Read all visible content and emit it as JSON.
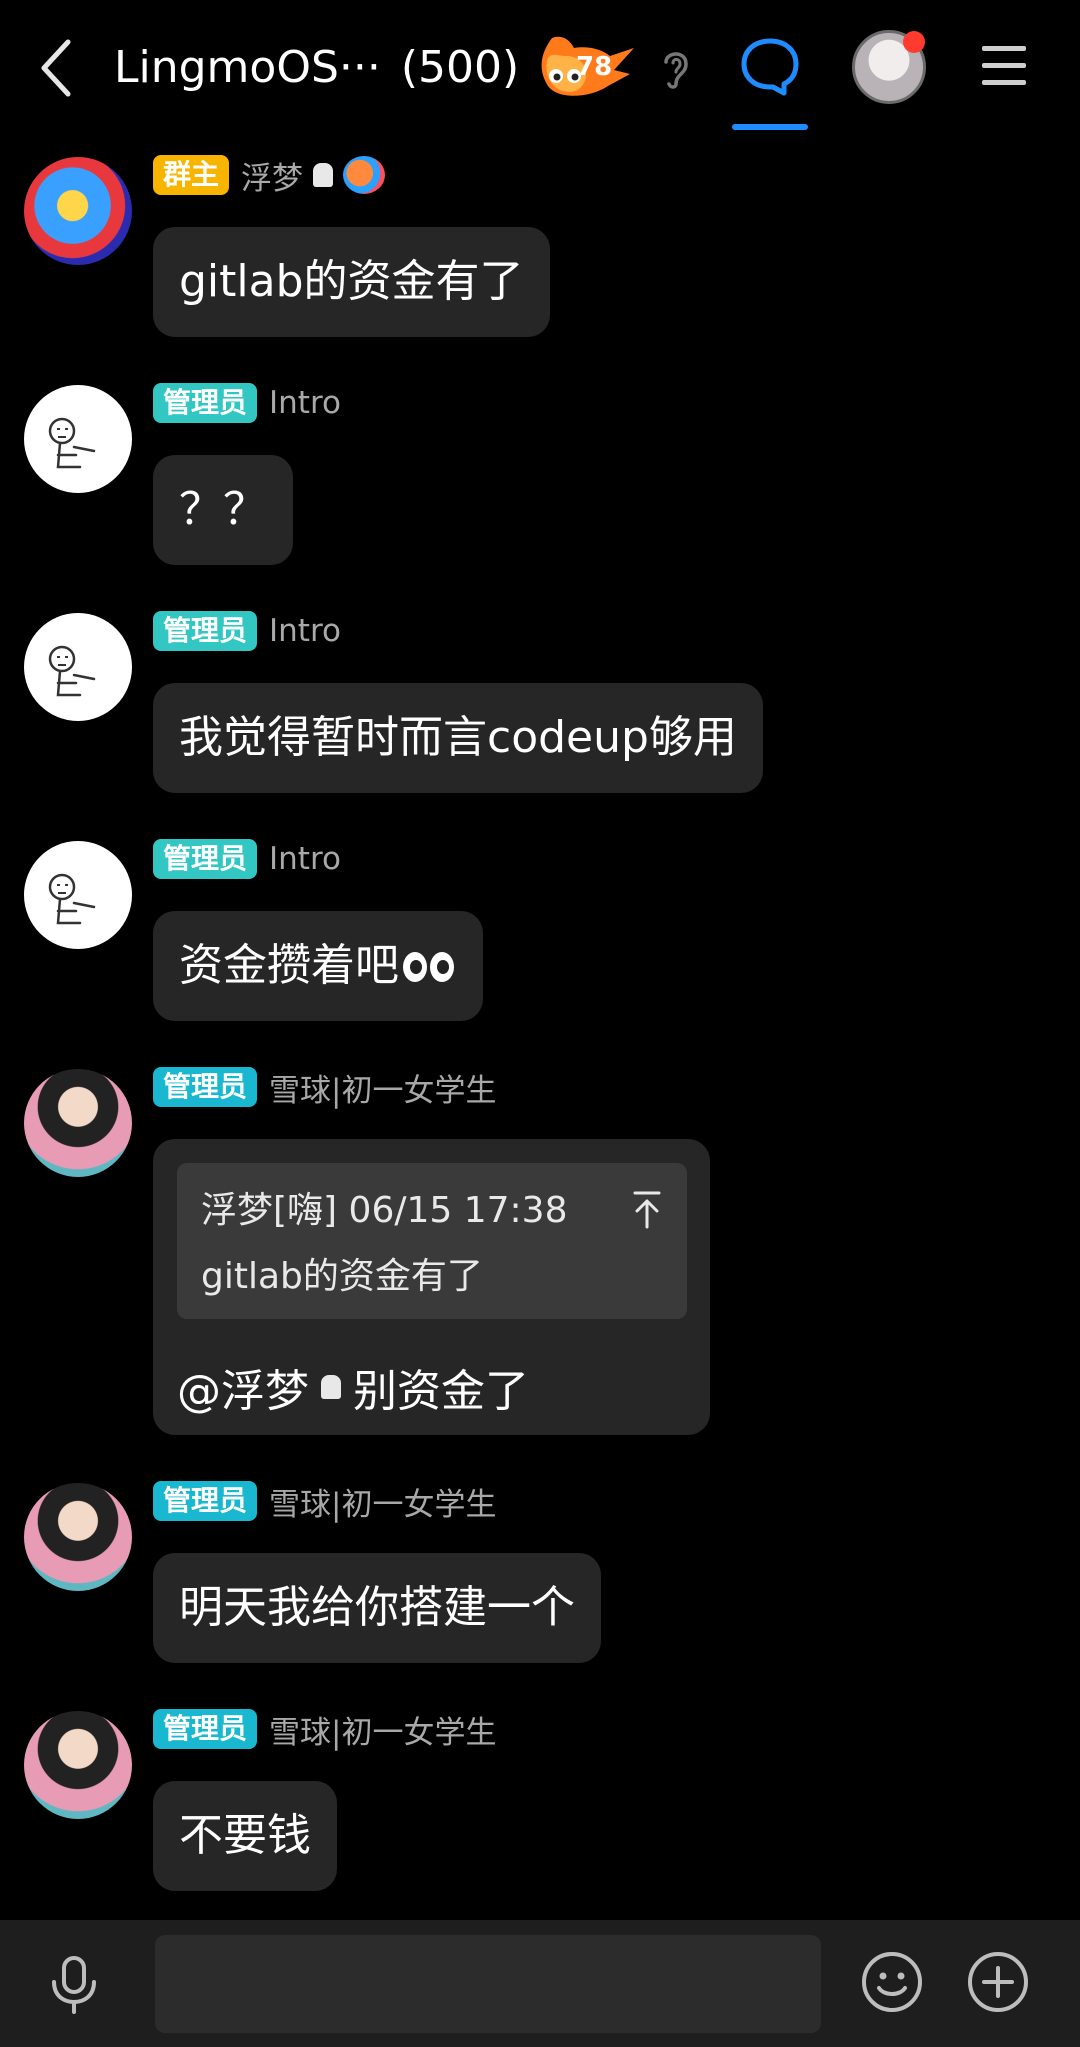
{
  "header": {
    "title": "LingmoOS···",
    "member_count": "(500)",
    "fire_level": "78",
    "icons": {
      "back": "chevron-left-icon",
      "fire": "fire-icon",
      "ear": "ear-icon",
      "chat": "chat-bubble-icon",
      "menu": "hamburger-menu-icon"
    },
    "active_tab_color": "#1e8cff",
    "notification_dot_color": "#ff3b30"
  },
  "messages": [
    {
      "sender": "浮梦",
      "role": "群主",
      "text": "gitlab的资金有了"
    },
    {
      "sender": "Intro",
      "role": "管理员",
      "text": "？？"
    },
    {
      "sender": "Intro",
      "role": "管理员",
      "text": "我觉得暂时而言codeup够用"
    },
    {
      "sender": "Intro",
      "role": "管理员",
      "text": "资金攒着吧"
    },
    {
      "sender": "雪球|初一女学生",
      "role": "管理员",
      "quote": {
        "header": "浮梦[嗨] 06/15 17:38",
        "text": "gitlab的资金有了"
      },
      "mention": "@浮梦",
      "text": "别资金了"
    },
    {
      "sender": "雪球|初一女学生",
      "role": "管理员",
      "text": "明天我给你搭建一个"
    },
    {
      "sender": "雪球|初一女学生",
      "role": "管理员",
      "text": "不要钱"
    }
  ],
  "colors": {
    "owner_tag": "#f7b500",
    "admin_tag": "#33c7c4",
    "bubble_bg": "#262626",
    "background": "#000000"
  },
  "bottom_bar": {
    "input_value": "",
    "icons": {
      "voice": "microphone-icon",
      "emoji": "emoji-smile-icon",
      "more": "plus-circle-icon"
    }
  }
}
